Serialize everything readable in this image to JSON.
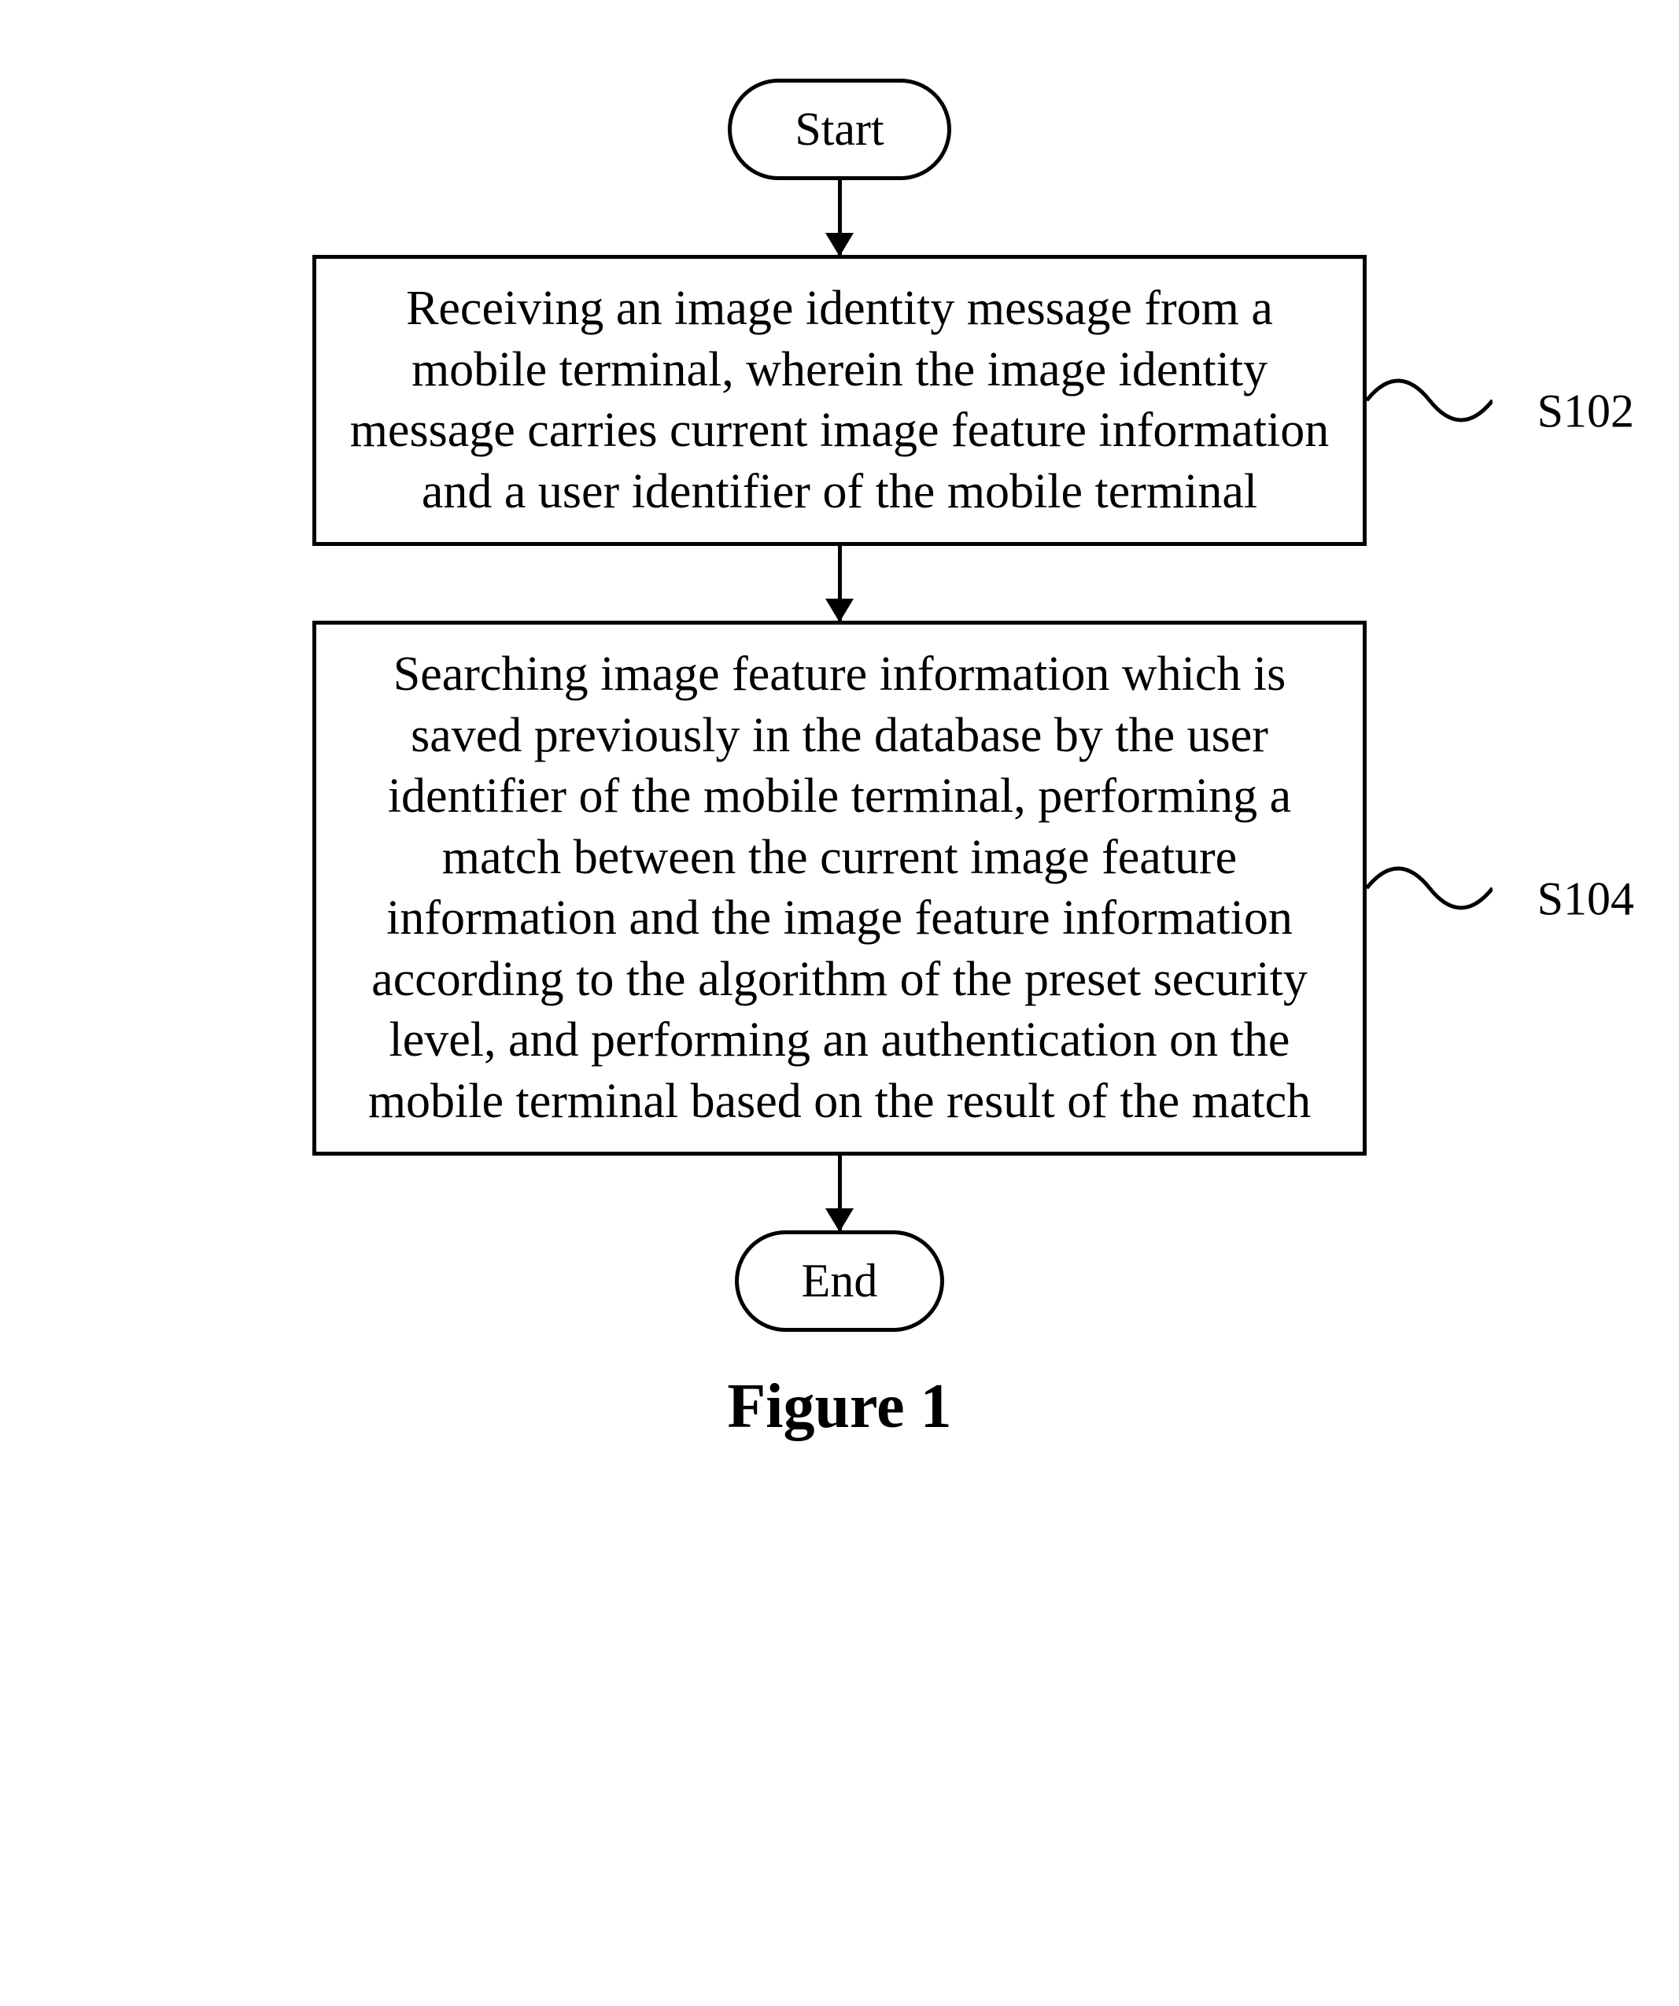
{
  "flowchart": {
    "start": "Start",
    "step1": {
      "text": "Receiving an image identity message from a mobile terminal, wherein the image identity message carries current image feature information and a user identifier of the mobile terminal",
      "label": "S102"
    },
    "step2": {
      "text": "Searching image feature information which is saved previously in the database by the user identifier of the mobile terminal, performing a match between the current image feature information and the image feature information according to the algorithm of the preset security level, and performing an authentication on the mobile terminal based on the result of the match",
      "label": "S104"
    },
    "end": "End",
    "caption": "Figure 1"
  }
}
